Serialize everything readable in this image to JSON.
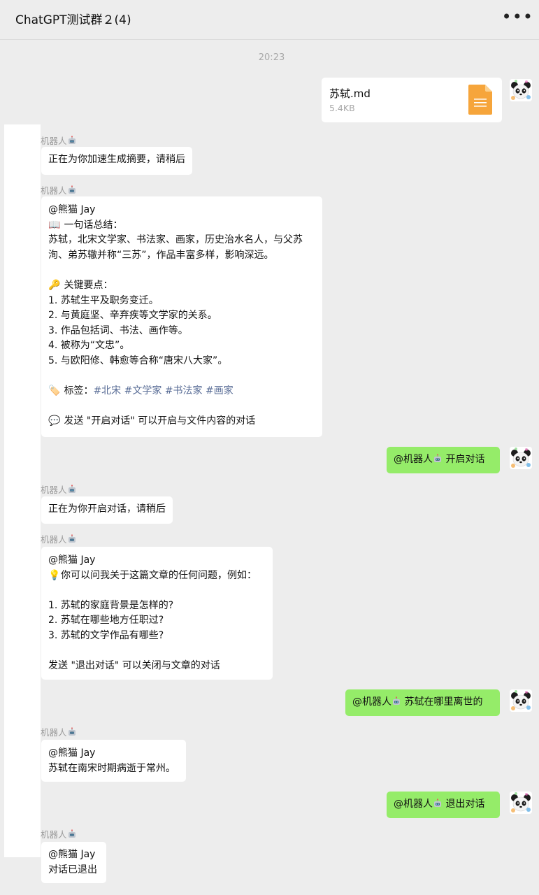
{
  "header": {
    "title": "ChatGPT测试群２(4)",
    "more_label": "•••"
  },
  "timestamp": "20:23",
  "bot_name": "机器人",
  "file": {
    "name": "苏轼.md",
    "size": "5.4KB"
  },
  "messages": {
    "m1": "正在为你加速生成摘要，请稍后",
    "summary": {
      "mention": "@熊猫 Jay",
      "l1_emoji": "📖",
      "l1": "一句话总结：",
      "l2": "苏轼，北宋文学家、书法家、画家，历史治水名人，与父苏",
      "l3": "洵、弟苏辙并称“三苏”，作品丰富多样，影响深远。",
      "l4_emoji": "🔑",
      "l4": "关键要点：",
      "k1": "1. 苏轼生平及职务变迁。",
      "k2": "2. 与黄庭坚、辛弃疾等文学家的关系。",
      "k3": "3. 作品包括词、书法、画作等。",
      "k4": "4. 被称为“文忠”。",
      "k5": "5. 与欧阳修、韩愈等合称“唐宋八大家”。",
      "tags_emoji": "🏷️",
      "tags_label": "标签：",
      "tags": [
        "#北宋",
        "#文学家",
        "#书法家",
        "#画家"
      ],
      "cta_emoji": "💬",
      "cta": "发送 \"开启对话\" 可以开启与文件内容的对话"
    },
    "out1": {
      "mention": "@机器人",
      "text": "开启对话"
    },
    "m3": "正在为你开启对话，请稍后",
    "chat_intro": {
      "mention": "@熊猫 Jay",
      "emoji": "💡",
      "l1": "你可以问我关于这篇文章的任何问题，例如：",
      "q1": "1. 苏轼的家庭背景是怎样的?",
      "q2": "2. 苏轼在哪些地方任职过?",
      "q3": "3. 苏轼的文学作品有哪些?",
      "l2": "发送 \"退出对话\" 可以关闭与文章的对话"
    },
    "out2": {
      "mention": "@机器人",
      "text": "苏轼在哪里离世的"
    },
    "answer": {
      "mention": "@熊猫 Jay",
      "text": "苏轼在南宋时期病逝于常州。"
    },
    "out3": {
      "mention": "@机器人",
      "text": "退出对话"
    },
    "exit": {
      "mention": "@熊猫 Jay",
      "text": "对话已退出"
    }
  },
  "colors": {
    "outgoing_bubble": "#95ec69",
    "incoming_bubble": "#ffffff",
    "tag_link": "#576b95",
    "background": "#ededed"
  },
  "icons": [
    "robot-icon",
    "panda-avatar-icon",
    "document-file-icon",
    "more-icon"
  ]
}
